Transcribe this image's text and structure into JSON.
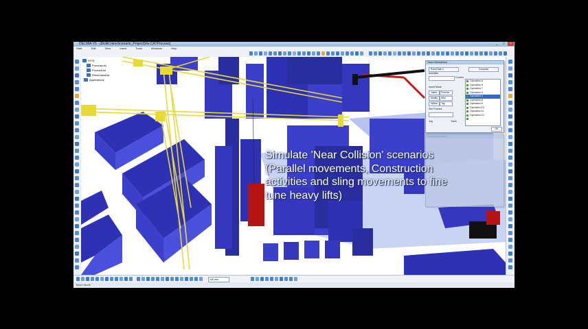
{
  "window": {
    "title": "DELMIA V5 - [MultiCraneScenario_ProjectSite.CATProcess]",
    "controls": [
      "_",
      "□",
      "×"
    ]
  },
  "menu": [
    "Start",
    "Edit",
    "View",
    "Insert",
    "Tools",
    "Windows",
    "Help"
  ],
  "tree": {
    "root": "P.P.R.",
    "items": [
      "ProcessList",
      "ProductList",
      "ResourcesList",
      "Applications"
    ]
  },
  "teach_panel": {
    "title": "Teach Mechanism",
    "mechanism": "RobotTask.2",
    "compass_label": "Compass",
    "activities_label": "Activities",
    "current_label": "Current",
    "insert_mode_label": "Insert Mode",
    "buttons": [
      "Insert",
      "Modify",
      "Delete"
    ],
    "fields": [
      "Process",
      "After",
      "Tag"
    ],
    "sim_frames_label": "Sim Frames",
    "jog_label": "Jog",
    "track_label": "Track",
    "operations": [
      "Operation.6",
      "Operation.5",
      "Operation.7",
      "Operation.4",
      "Operation.3",
      "Operation.8",
      "Operation.9",
      "Operation.10",
      "Operation.11",
      "Operation.12"
    ],
    "selected_index": 4,
    "ok_label": "OK"
  },
  "second_panel": {
    "title": "Teach Mechanism"
  },
  "status": {
    "text": "Teach Mode",
    "zoom": "100 mm"
  },
  "caption": {
    "line1": "Simulate 'Near Collision' scenarios",
    "line2": "(Parallel movements, Construction",
    "line3": "activities and sling movements to fine",
    "line4": "tune heavy lifts)"
  },
  "colors": {
    "building": "#3b3fc9",
    "building_dark": "#23268a",
    "crane": "#e7d93a",
    "load": "#b41414",
    "ground": "#ffffff",
    "caption_box": "#aab8dc"
  }
}
